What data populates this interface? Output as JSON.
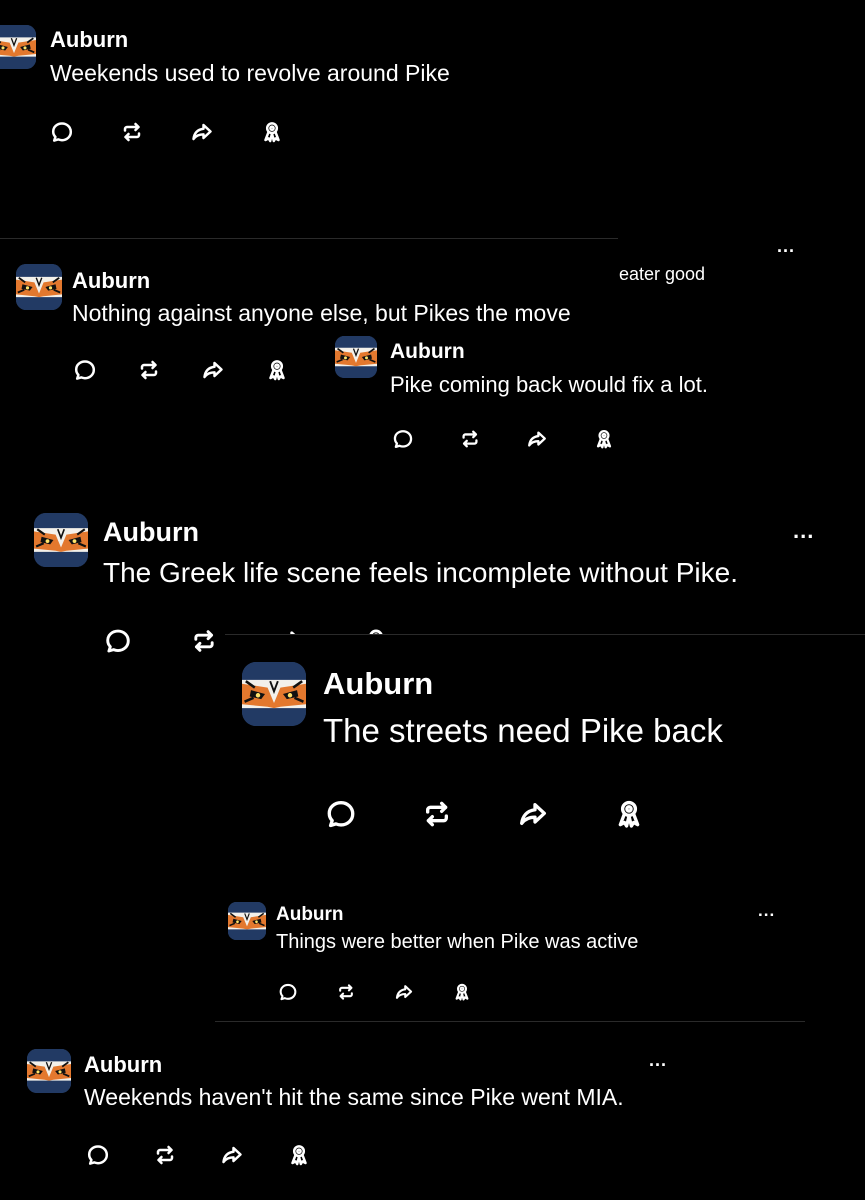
{
  "icons": {
    "avatar": "tiger-face-logo",
    "reply": "speech-bubble-icon",
    "repost": "repost-arrows-icon",
    "share": "share-arrow-icon",
    "badge": "ribbon-badge-icon",
    "more": "more-options-icon"
  },
  "colors": {
    "background": "#000000",
    "text": "#ffffff",
    "avatar_blue": "#223a64",
    "avatar_orange": "#e3782e"
  },
  "posts": [
    {
      "username": "Auburn",
      "text": "Weekends used to revolve around Pike"
    },
    {
      "username": "Auburn",
      "text": "Nothing against anyone else, but Pikes the move",
      "more": "..."
    },
    {
      "username": "Auburn",
      "text": "Pike coming back would fix a lot."
    },
    {
      "username": "Auburn",
      "text": "The Greek life scene feels incomplete without Pike.",
      "more": "..."
    },
    {
      "username": "Auburn",
      "text": "The streets need Pike back"
    },
    {
      "username": "Auburn",
      "text": "Things were better when Pike was active",
      "more": "..."
    },
    {
      "username": "Auburn",
      "text": "Weekends haven't hit the same since Pike went MIA.",
      "more": "..."
    }
  ],
  "fragments": {
    "partial_text": "eater good"
  }
}
